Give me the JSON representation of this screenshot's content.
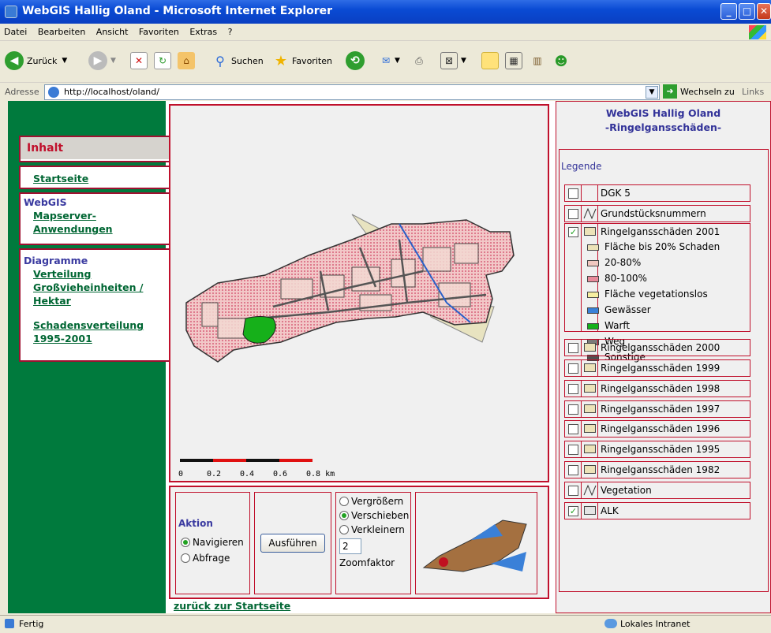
{
  "window": {
    "title": "WebGIS Hallig Oland - Microsoft Internet Explorer"
  },
  "menu": [
    "Datei",
    "Bearbeiten",
    "Ansicht",
    "Favoriten",
    "Extras",
    "?"
  ],
  "toolbar": {
    "back": "Zurück",
    "search": "Suchen",
    "favorites": "Favoriten"
  },
  "address": {
    "label": "Adresse",
    "url": "http://localhost/oland/",
    "go": "Wechseln zu",
    "links": "Links"
  },
  "nav": {
    "inhalt": "Inhalt",
    "startseite": "Startseite",
    "webgis_head": "WebGIS",
    "mapserver_1": "Mapserver-",
    "mapserver_2": "Anwendungen",
    "diagramme_head": "Diagramme",
    "verteilung_1": "Verteilung",
    "verteilung_2": "Großvieheinheiten /",
    "verteilung_3": "Hektar",
    "schaden_1": "Schadensverteilung",
    "schaden_2": "1995-2001"
  },
  "map": {
    "scale_labels": [
      "0",
      "0.2",
      "0.4",
      "0.6",
      "0.8 km"
    ]
  },
  "controls": {
    "aktion": "Aktion",
    "navigieren": "Navigieren",
    "abfrage": "Abfrage",
    "ausfuehren": "Ausführen",
    "vergroessern": "Vergrößern",
    "verschieben": "Verschieben",
    "verkleinern": "Verkleinern",
    "zoom_value": "2",
    "zoomfaktor": "Zoomfaktor"
  },
  "right": {
    "title1": "WebGIS Hallig Oland",
    "title2": "-Ringelgansschäden-",
    "legende": "Legende"
  },
  "layers": [
    {
      "label": "DGK 5",
      "checked": false,
      "swatch": "none"
    },
    {
      "label": "Grundstücksnummern",
      "checked": false,
      "swatch": "line"
    },
    {
      "label": "Ringelgansschäden 2001",
      "checked": true,
      "swatch": "box"
    },
    {
      "label": "Ringelgansschäden 2000",
      "checked": false,
      "swatch": "box"
    },
    {
      "label": "Ringelgansschäden 1999",
      "checked": false,
      "swatch": "box"
    },
    {
      "label": "Ringelgansschäden 1998",
      "checked": false,
      "swatch": "box"
    },
    {
      "label": "Ringelgansschäden 1997",
      "checked": false,
      "swatch": "box"
    },
    {
      "label": "Ringelgansschäden 1996",
      "checked": false,
      "swatch": "box"
    },
    {
      "label": "Ringelgansschäden 1995",
      "checked": false,
      "swatch": "box"
    },
    {
      "label": "Ringelgansschäden 1982",
      "checked": false,
      "swatch": "box"
    },
    {
      "label": "Vegetation",
      "checked": false,
      "swatch": "line"
    },
    {
      "label": "ALK",
      "checked": true,
      "swatch": "gray"
    }
  ],
  "legend_items": [
    {
      "label": "Fläche bis 20% Schaden",
      "color": "#ece2b8"
    },
    {
      "label": "20-80%",
      "color": "#f0c8c0"
    },
    {
      "label": "80-100%",
      "color": "#e88a9a"
    },
    {
      "label": "Fläche vegetationslos",
      "color": "#f6eea0"
    },
    {
      "label": "Gewässer",
      "color": "#3a80d8"
    },
    {
      "label": "Warft",
      "color": "#16b01a"
    },
    {
      "label": "Weg",
      "color": "#7a7a7a"
    },
    {
      "label": "Sonstige",
      "color": "#505050"
    }
  ],
  "back_link": "zurück zur Startseite",
  "status": {
    "text": "Fertig",
    "zone": "Lokales Intranet"
  }
}
